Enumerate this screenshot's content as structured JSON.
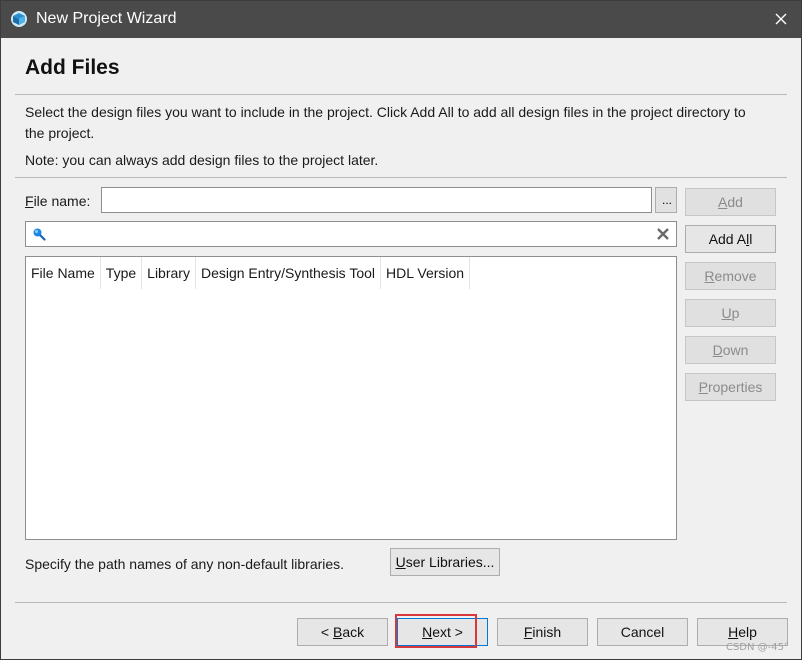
{
  "window": {
    "title": "New Project Wizard"
  },
  "page": {
    "title": "Add Files",
    "description": "Select the design files you want to include in the project. Click Add All to add all design files in the project directory to the project.",
    "note": "Note: you can always add design files to the project later."
  },
  "file_name": {
    "label_mnemonic": "F",
    "label_rest": "ile name:",
    "value": "",
    "browse_label": "..."
  },
  "search": {
    "value": ""
  },
  "table": {
    "columns": [
      "File Name",
      "Type",
      "Library",
      "Design Entry/Synthesis Tool",
      "HDL Version"
    ],
    "rows": []
  },
  "side_buttons": {
    "add": {
      "mn": "A",
      "rest": "dd"
    },
    "add_all": {
      "pre": "Add A",
      "mn": "l",
      "post": "l"
    },
    "remove": {
      "mn": "R",
      "rest": "emove"
    },
    "up": {
      "mn": "U",
      "rest": "p"
    },
    "down": {
      "mn": "D",
      "rest": "own"
    },
    "properties": {
      "mn": "P",
      "rest": "roperties"
    }
  },
  "libraries": {
    "text": "Specify the path names of any non-default libraries.",
    "btn_mn": "U",
    "btn_rest": "ser Libraries..."
  },
  "footer": {
    "back": {
      "pre": "< ",
      "mn": "B",
      "post": "ack"
    },
    "next": {
      "mn": "N",
      "post": "ext >"
    },
    "finish": {
      "mn": "F",
      "post": "inish"
    },
    "cancel": "Cancel",
    "help": {
      "mn": "H",
      "post": "elp"
    }
  },
  "watermark": "CSDN @-45°"
}
